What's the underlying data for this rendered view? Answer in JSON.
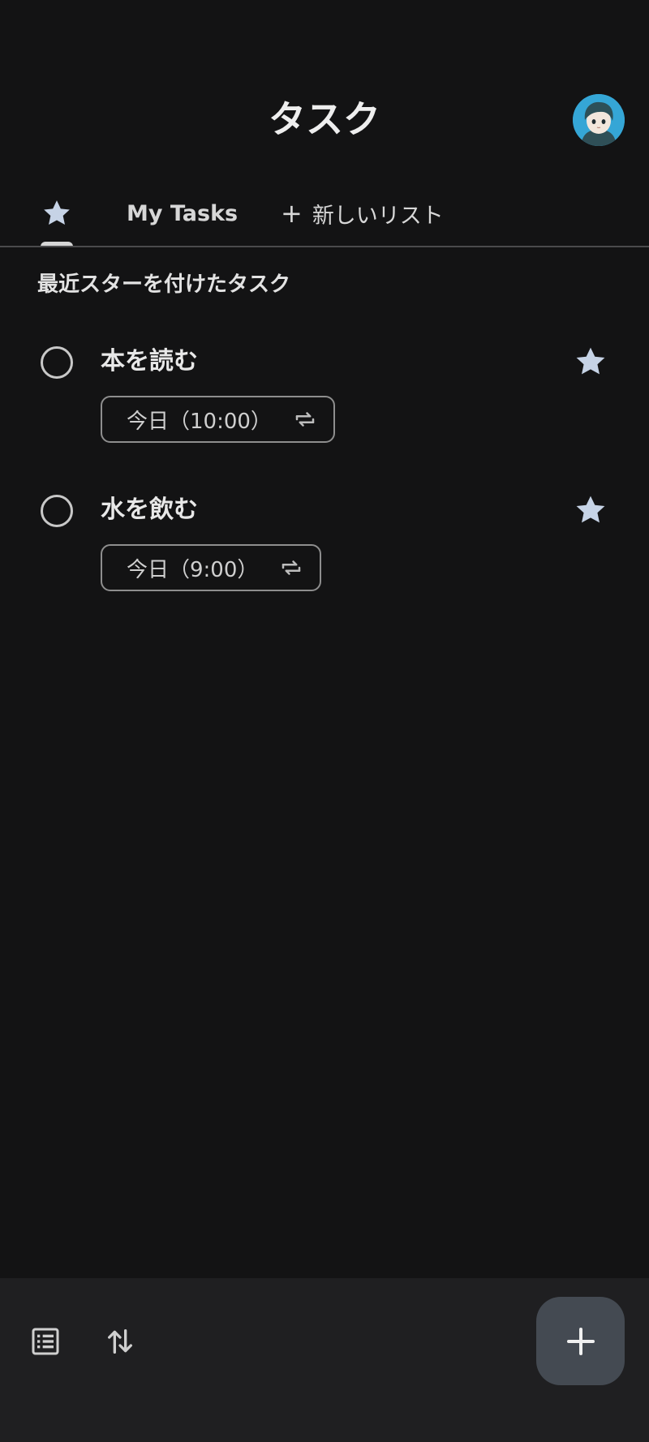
{
  "header": {
    "title": "タスク",
    "avatar_icon": "user-avatar"
  },
  "tabs": {
    "starred_icon": "star-icon",
    "my_tasks_label": "My Tasks",
    "new_list_label": "新しいリスト"
  },
  "section": {
    "heading": "最近スターを付けたタスク"
  },
  "tasks": [
    {
      "title": "本を読む",
      "due": "今日（10:00）",
      "repeat": true,
      "starred": true
    },
    {
      "title": "水を飲む",
      "due": "今日（9:00）",
      "repeat": true,
      "starred": true
    }
  ],
  "bottom_bar": {
    "list_icon": "list-icon",
    "sort_icon": "sort-icon",
    "fab_icon": "plus-icon"
  },
  "colors": {
    "background": "#131314",
    "bottom_bar": "#1f1f21",
    "fab": "#444a52",
    "star": "#c6d3e6",
    "avatar": "#35a6d6"
  }
}
